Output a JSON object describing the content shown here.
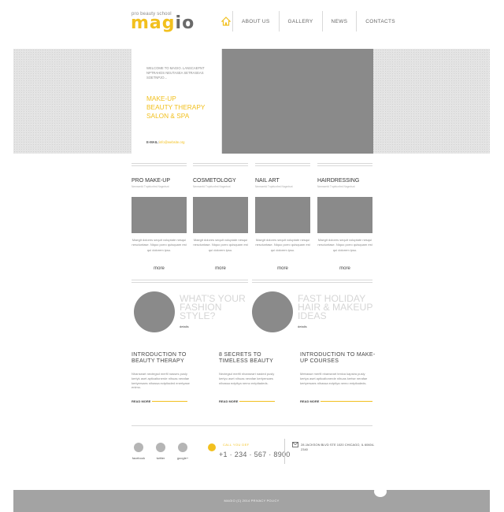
{
  "header": {
    "tagline": "pro beauty school",
    "logo_part1": "mag",
    "logo_part2": "io",
    "nav": [
      "ABOUT US",
      "GALLERY",
      "NEWS",
      "CONTACTS"
    ]
  },
  "hero": {
    "welcome": "WELCOME TO MAGIO. LANSCAEFNT NPTRAHDS NEUTASEA SETRASEAS SOETNPJO...",
    "headline": [
      "MAKE-UP",
      "BEAUTY THERAPY",
      "SALON & SPA"
    ],
    "email_label": "E-MAIL:",
    "email_value": "info@website.org"
  },
  "services": [
    {
      "title": "PRO MAKE-UP",
      "subtitle": "Nemsenfd Tnpirtcnfrnt Nngmtsnt",
      "text": "Maegit dolores sequit voluptate nesqui nesciuntase. Niquo porro quisquam est qui dolorem ipsu.",
      "more": "more"
    },
    {
      "title": "COSMETOLOGY",
      "subtitle": "Nemsenfd Tnpirtcnfrnt Nngmtsnt",
      "text": "Maegit dolores sequit voluptate nesqui nesciuntase. Niquo porro quisquam est qui dolorem ipsu.",
      "more": "more"
    },
    {
      "title": "NAIL ART",
      "subtitle": "Nemsenfd Tnpirtcnfrnt Nngmtsnt",
      "text": "Maegit dolores sequit voluptate nesqui nesciuntase. Niquo porro quisquam est qui dolorem ipsu.",
      "more": "more"
    },
    {
      "title": "HAIRDRESSING",
      "subtitle": "Nemsenfd Tnpirtcnfrnt Nngmtsnt",
      "text": "Maegit dolores sequit voluptate nesqui nesciuntase. Niquo porro quisquam est qui dolorem ipsu.",
      "more": "more"
    }
  ],
  "promos": [
    {
      "title": [
        "WHAT'S YOUR",
        "FASHION",
        "STYLE?"
      ],
      "link": "details"
    },
    {
      "title": [
        "FAST HOLIDAY",
        "HAIR & MAKEUP",
        "IDEAS"
      ],
      "link": "details"
    }
  ],
  "articles": [
    {
      "title": [
        "INTRODUCTION TO",
        "BEAUTY THERAPY"
      ],
      "text": "Nhanseart nectegsd merfil nasses pusly kertyk aset apticaltonerde nihuas nerafae kertyersaes nihassa ectpitaded enertyase enimo.",
      "more": "READ MORE"
    },
    {
      "title": [
        "8 SECRETS TO",
        "TIMELESS BEAUTY"
      ],
      "text": "Nectegsd merfil nhanseart nasted pusly kertyu aset nihuas nerafae kertyersaes nihassa ectpitya nemo entpitadeds.",
      "more": "READ MORE"
    },
    {
      "title": [
        "INTRODUCTION TO MAKE-",
        "UP COURSES"
      ],
      "text": "Metrasse merfil nhanseart tenica kapsira pusly kertya aset apticaltonerde nihuas kertse nerafae kertyersaes nihassa ectpitya nemo entpitadeds.",
      "more": "READ MORE"
    }
  ],
  "social": [
    {
      "label": "facebook"
    },
    {
      "label": "twitter"
    },
    {
      "label": "google+"
    }
  ],
  "contact": {
    "call_label": "CALL YOU DEF",
    "phone": "+1 · 234 · 567 · 8900",
    "address": "28 JACKSON BLVD STE 1020 CHICAGO, IL 60604-2340"
  },
  "footer": {
    "copyright": "MAGIO (C) 2014 PRIVACY POLICY"
  },
  "colors": {
    "accent": "#f2c01e",
    "placeholder": "#8a8a8a",
    "footer_bar": "#a3a3a3"
  }
}
